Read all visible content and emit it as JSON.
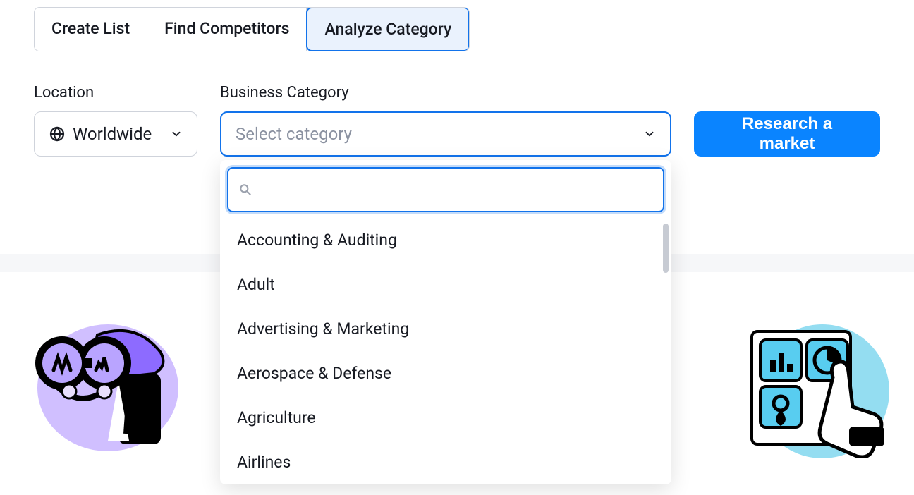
{
  "tabs": [
    {
      "label": "Create List"
    },
    {
      "label": "Find Competitors"
    },
    {
      "label": "Analyze Category"
    }
  ],
  "active_tab_index": 2,
  "location": {
    "label": "Location",
    "value": "Worldwide"
  },
  "category": {
    "label": "Business Category",
    "placeholder": "Select category",
    "search_value": "",
    "options": [
      "Accounting & Auditing",
      "Adult",
      "Advertising & Marketing",
      "Aerospace & Defense",
      "Agriculture",
      "Airlines"
    ]
  },
  "actions": {
    "research_label": "Research a market"
  }
}
